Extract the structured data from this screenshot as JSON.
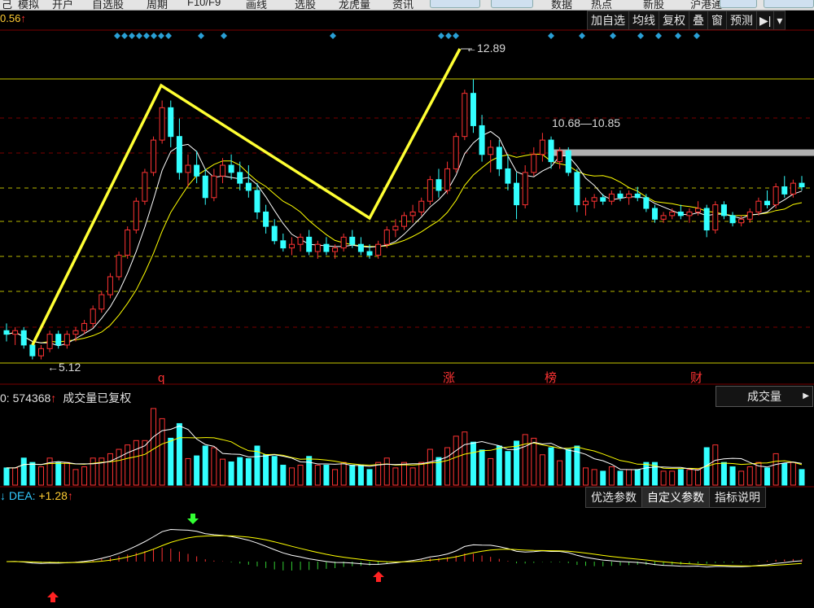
{
  "menu": [
    {
      "label": "己"
    },
    {
      "label": "模拟"
    },
    {
      "label": "开户"
    },
    {
      "label": "自选股"
    },
    {
      "label": "周期"
    },
    {
      "label": "F10/F9"
    },
    {
      "label": "画线"
    },
    {
      "label": "选股"
    },
    {
      "label": "龙虎量"
    },
    {
      "label": "资讯"
    },
    {
      "label": "数据"
    },
    {
      "label": "热点"
    },
    {
      "label": "新股"
    },
    {
      "label": "沪港通"
    }
  ],
  "price_label": {
    "value": "0.56",
    "arrow": "↑"
  },
  "toolbar": [
    {
      "label": "加自选"
    },
    {
      "label": "均线"
    },
    {
      "label": "复权"
    },
    {
      "label": "叠"
    },
    {
      "label": "窗"
    },
    {
      "label": "预测"
    },
    {
      "label": "▶|"
    },
    {
      "label": "▾"
    }
  ],
  "annotations": {
    "high_label": "12.89",
    "low_label": "5.12",
    "range_label": "10.68—10.85"
  },
  "events": [
    {
      "label": "q",
      "color": "#ff3333"
    },
    {
      "label": "涨",
      "color": "#ff3333"
    },
    {
      "label": "榜",
      "color": "#ff3333"
    },
    {
      "label": "财",
      "color": "#ff3333"
    }
  ],
  "volume": {
    "value": "574368",
    "prefix": "0: ",
    "arrow": "↑",
    "note": "成交量已复权",
    "selector": "成交量"
  },
  "macd": {
    "prefix": "↓ DEA: ",
    "dea": "+1.28",
    "arrow": "↑"
  },
  "indicator_tabs": [
    {
      "label": "优选参数"
    },
    {
      "label": "自定义参数"
    },
    {
      "label": "指标说明"
    }
  ],
  "colors": {
    "up": "#ff3333",
    "down": "#33ffff",
    "ma_fast": "#ffffff",
    "ma_slow": "#ffff00",
    "zigzag": "#ffff33",
    "signal": "#3399cc"
  },
  "chart_data": {
    "type": "candlestick",
    "price_high": 12.89,
    "price_low": 5.12,
    "resistance_band": [
      10.68,
      10.85
    ],
    "zigzag_prices": [
      5.12,
      12.3,
      7.0,
      12.89
    ],
    "candles": [
      [
        5.9,
        6.1,
        5.6,
        5.8
      ],
      [
        5.8,
        6.0,
        5.5,
        5.9
      ],
      [
        5.9,
        6.0,
        5.4,
        5.5
      ],
      [
        5.5,
        5.6,
        5.1,
        5.2
      ],
      [
        5.2,
        5.5,
        5.1,
        5.4
      ],
      [
        5.4,
        5.9,
        5.3,
        5.8
      ],
      [
        5.8,
        5.9,
        5.4,
        5.5
      ],
      [
        5.5,
        5.9,
        5.4,
        5.8
      ],
      [
        5.8,
        6.0,
        5.6,
        5.9
      ],
      [
        5.9,
        6.2,
        5.8,
        6.1
      ],
      [
        6.1,
        6.6,
        6.0,
        6.5
      ],
      [
        6.5,
        7.0,
        6.4,
        6.9
      ],
      [
        6.9,
        7.5,
        6.8,
        7.4
      ],
      [
        7.4,
        8.1,
        7.3,
        8.0
      ],
      [
        8.0,
        8.8,
        7.9,
        8.7
      ],
      [
        8.7,
        9.6,
        8.6,
        9.5
      ],
      [
        9.5,
        10.4,
        9.4,
        10.3
      ],
      [
        10.3,
        11.3,
        10.2,
        11.2
      ],
      [
        11.2,
        12.3,
        11.1,
        12.1
      ],
      [
        12.1,
        12.3,
        11.0,
        11.3
      ],
      [
        11.3,
        11.8,
        10.1,
        10.3
      ],
      [
        10.3,
        10.8,
        9.9,
        10.5
      ],
      [
        10.5,
        10.9,
        10.0,
        10.2
      ],
      [
        10.2,
        10.4,
        9.4,
        9.6
      ],
      [
        9.6,
        10.4,
        9.5,
        10.2
      ],
      [
        10.2,
        10.7,
        10.0,
        10.5
      ],
      [
        10.5,
        10.8,
        10.1,
        10.3
      ],
      [
        10.3,
        10.6,
        9.8,
        10.0
      ],
      [
        10.0,
        10.5,
        9.6,
        9.8
      ],
      [
        9.8,
        10.0,
        9.0,
        9.2
      ],
      [
        9.2,
        9.4,
        8.6,
        8.8
      ],
      [
        8.8,
        9.0,
        8.3,
        8.4
      ],
      [
        8.4,
        8.6,
        8.1,
        8.2
      ],
      [
        8.2,
        8.5,
        8.0,
        8.3
      ],
      [
        8.3,
        8.6,
        8.1,
        8.5
      ],
      [
        8.5,
        8.7,
        8.0,
        8.1
      ],
      [
        8.1,
        8.4,
        7.9,
        8.3
      ],
      [
        8.3,
        8.5,
        8.0,
        8.1
      ],
      [
        8.1,
        8.3,
        7.9,
        8.2
      ],
      [
        8.2,
        8.6,
        8.1,
        8.5
      ],
      [
        8.5,
        8.7,
        8.2,
        8.3
      ],
      [
        8.3,
        8.5,
        8.0,
        8.1
      ],
      [
        8.1,
        8.3,
        7.9,
        8.0
      ],
      [
        8.0,
        8.4,
        7.9,
        8.3
      ],
      [
        8.3,
        8.8,
        8.2,
        8.7
      ],
      [
        8.7,
        9.0,
        8.5,
        8.8
      ],
      [
        8.8,
        9.2,
        8.7,
        9.1
      ],
      [
        9.1,
        9.4,
        8.9,
        9.2
      ],
      [
        9.2,
        9.6,
        9.1,
        9.5
      ],
      [
        9.5,
        10.2,
        9.4,
        10.1
      ],
      [
        10.1,
        10.4,
        9.6,
        9.8
      ],
      [
        9.8,
        10.6,
        9.7,
        10.4
      ],
      [
        10.4,
        11.4,
        10.3,
        11.3
      ],
      [
        11.3,
        12.6,
        11.2,
        12.5
      ],
      [
        12.5,
        12.89,
        11.4,
        11.6
      ],
      [
        11.6,
        11.9,
        10.6,
        10.8
      ],
      [
        10.8,
        11.2,
        10.3,
        11.0
      ],
      [
        11.0,
        11.2,
        10.2,
        10.4
      ],
      [
        10.4,
        10.8,
        9.8,
        10.0
      ],
      [
        10.0,
        10.3,
        9.0,
        9.4
      ],
      [
        9.4,
        10.5,
        9.3,
        10.3
      ],
      [
        10.3,
        11.0,
        10.2,
        10.8
      ],
      [
        10.8,
        11.4,
        10.6,
        11.2
      ],
      [
        11.2,
        11.3,
        10.4,
        10.6
      ],
      [
        10.6,
        11.0,
        10.4,
        10.9
      ],
      [
        10.9,
        11.0,
        10.2,
        10.3
      ],
      [
        10.3,
        10.4,
        9.2,
        9.4
      ],
      [
        9.4,
        9.6,
        9.1,
        9.5
      ],
      [
        9.5,
        9.7,
        9.3,
        9.6
      ],
      [
        9.6,
        9.7,
        9.4,
        9.5
      ],
      [
        9.5,
        9.8,
        9.4,
        9.7
      ],
      [
        9.7,
        9.8,
        9.5,
        9.6
      ],
      [
        9.6,
        9.8,
        9.4,
        9.7
      ],
      [
        9.7,
        9.9,
        9.5,
        9.6
      ],
      [
        9.6,
        9.7,
        9.2,
        9.3
      ],
      [
        9.3,
        9.4,
        8.9,
        9.0
      ],
      [
        9.0,
        9.2,
        8.9,
        9.1
      ],
      [
        9.1,
        9.3,
        9.0,
        9.2
      ],
      [
        9.2,
        9.4,
        9.0,
        9.1
      ],
      [
        9.1,
        9.3,
        8.9,
        9.2
      ],
      [
        9.2,
        9.5,
        9.1,
        9.3
      ],
      [
        9.3,
        9.4,
        8.5,
        8.7
      ],
      [
        8.7,
        9.5,
        8.6,
        9.4
      ],
      [
        9.4,
        9.5,
        9.0,
        9.1
      ],
      [
        9.1,
        9.2,
        8.8,
        8.9
      ],
      [
        8.9,
        9.1,
        8.8,
        9.0
      ],
      [
        9.0,
        9.3,
        8.9,
        9.2
      ],
      [
        9.2,
        9.6,
        9.1,
        9.5
      ],
      [
        9.5,
        9.8,
        9.3,
        9.4
      ],
      [
        9.4,
        10.0,
        9.3,
        9.9
      ],
      [
        9.9,
        10.2,
        9.6,
        9.7
      ],
      [
        9.7,
        10.1,
        9.6,
        10.0
      ],
      [
        10.0,
        10.2,
        9.8,
        9.9
      ]
    ]
  }
}
